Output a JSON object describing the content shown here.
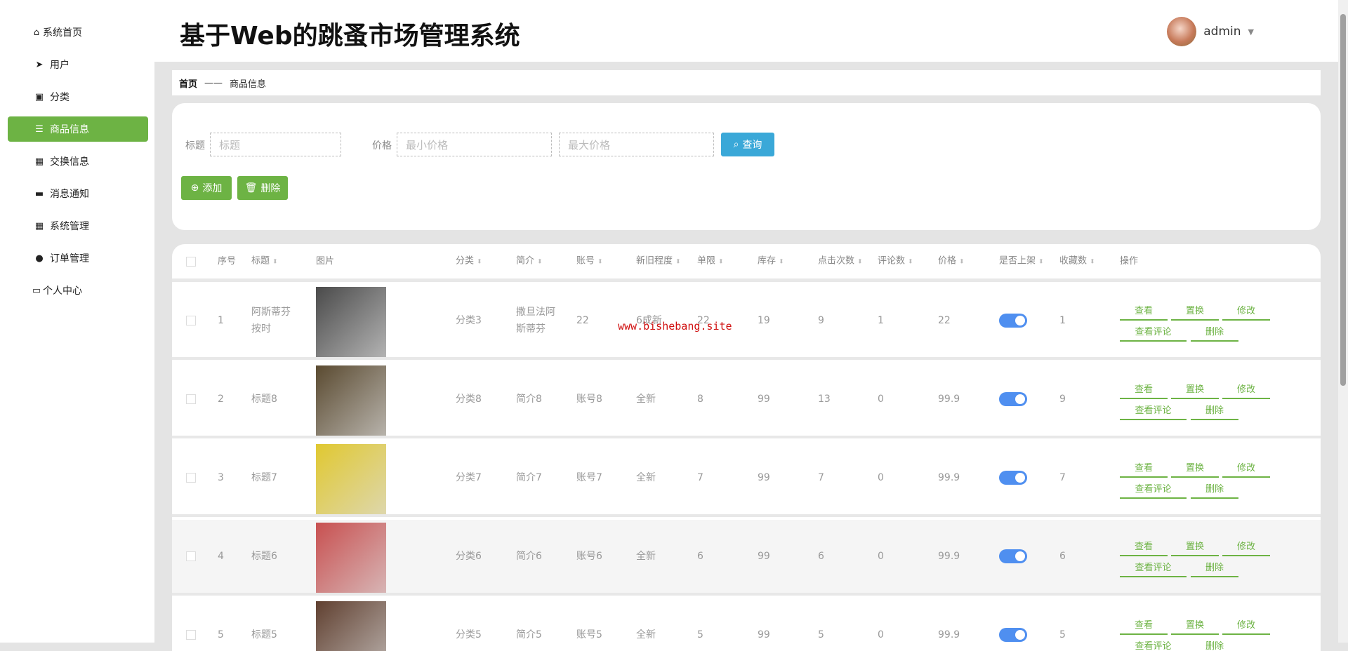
{
  "sidebar": {
    "items": [
      {
        "label": "系统首页",
        "icon": "home-icon"
      },
      {
        "label": "用户",
        "icon": "paper-plane-icon"
      },
      {
        "label": "分类",
        "icon": "clipboard-icon"
      },
      {
        "label": "商品信息",
        "icon": "sliders-icon",
        "active": true
      },
      {
        "label": "交换信息",
        "icon": "grid-icon"
      },
      {
        "label": "消息通知",
        "icon": "inbox-icon"
      },
      {
        "label": "系统管理",
        "icon": "grid-icon"
      },
      {
        "label": "订单管理",
        "icon": "user-icon"
      },
      {
        "label": "个人中心",
        "icon": "id-card-icon"
      }
    ]
  },
  "header": {
    "title": "基于Web的跳蚤市场管理系统",
    "user": "admin"
  },
  "breadcrumb": {
    "home": "首页",
    "sep": "——",
    "current": "商品信息"
  },
  "search": {
    "title_label": "标题",
    "title_placeholder": "标题",
    "price_label": "价格",
    "min_placeholder": "最小价格",
    "max_placeholder": "最大价格",
    "query": "查询",
    "add": "添加",
    "delete": "删除"
  },
  "table": {
    "headers": [
      "序号",
      "标题",
      "图片",
      "分类",
      "简介",
      "账号",
      "新旧程度",
      "单限",
      "库存",
      "点击次数",
      "评论数",
      "价格",
      "是否上架",
      "收藏数",
      "操作"
    ],
    "sortable": [
      false,
      true,
      false,
      true,
      true,
      true,
      true,
      true,
      true,
      true,
      true,
      true,
      true,
      true,
      false
    ],
    "actions": [
      "查看",
      "置换",
      "修改",
      "查看评论",
      "删除"
    ],
    "rows": [
      {
        "no": "1",
        "title": "阿斯蒂芬按时",
        "cat": "分类3",
        "intro": "撒旦法阿斯蒂芬",
        "account": "22",
        "cond": "6成新",
        "limit": "22",
        "stock": "19",
        "clicks": "9",
        "comments": "1",
        "price": "22",
        "listed": true,
        "favs": "1",
        "img": "#4a4a4a"
      },
      {
        "no": "2",
        "title": "标题8",
        "cat": "分类8",
        "intro": "简介8",
        "account": "账号8",
        "cond": "全新",
        "limit": "8",
        "stock": "99",
        "clicks": "13",
        "comments": "0",
        "price": "99.9",
        "listed": true,
        "favs": "9",
        "img": "#5a4a30"
      },
      {
        "no": "3",
        "title": "标题7",
        "cat": "分类7",
        "intro": "简介7",
        "account": "账号7",
        "cond": "全新",
        "limit": "7",
        "stock": "99",
        "clicks": "7",
        "comments": "0",
        "price": "99.9",
        "listed": true,
        "favs": "7",
        "img": "#e0c830"
      },
      {
        "no": "4",
        "title": "标题6",
        "cat": "分类6",
        "intro": "简介6",
        "account": "账号6",
        "cond": "全新",
        "limit": "6",
        "stock": "99",
        "clicks": "6",
        "comments": "0",
        "price": "99.9",
        "listed": true,
        "favs": "6",
        "img": "#c85050"
      },
      {
        "no": "5",
        "title": "标题5",
        "cat": "分类5",
        "intro": "简介5",
        "account": "账号5",
        "cond": "全新",
        "limit": "5",
        "stock": "99",
        "clicks": "5",
        "comments": "0",
        "price": "99.9",
        "listed": true,
        "favs": "5",
        "img": "#604030"
      }
    ]
  },
  "watermark": "www.bishebang.site"
}
